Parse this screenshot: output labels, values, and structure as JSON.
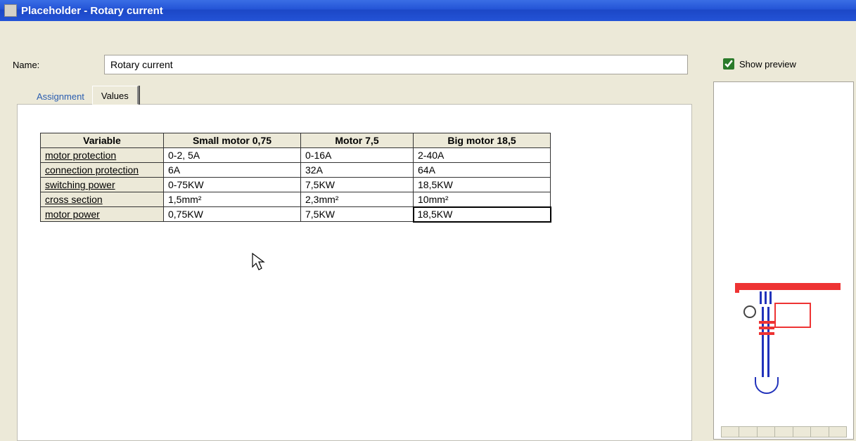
{
  "window": {
    "title": "Placeholder - Rotary current"
  },
  "name": {
    "label": "Name:",
    "value": "Rotary current"
  },
  "preview": {
    "label": "Show preview",
    "checked": true
  },
  "tabs": {
    "assignment": "Assignment",
    "values": "Values",
    "active": "values"
  },
  "table": {
    "headers": {
      "variable": "Variable",
      "columns": [
        "Small motor 0,75",
        "Motor 7,5",
        "Big motor 18,5"
      ]
    },
    "rows": [
      {
        "var": "motor protection",
        "cells": [
          "0-2, 5A",
          "0-16A",
          "2-40A"
        ]
      },
      {
        "var": "connection protection",
        "cells": [
          "6A",
          "32A",
          "64A"
        ]
      },
      {
        "var": "switching power",
        "cells": [
          "0-75KW",
          "7,5KW",
          "18,5KW"
        ]
      },
      {
        "var": "cross section",
        "cells": [
          "1,5mm²",
          "2,3mm²",
          "10mm²"
        ]
      },
      {
        "var": "motor power",
        "cells": [
          "0,75KW",
          "7,5KW",
          "18,5KW"
        ]
      }
    ],
    "selected": {
      "row": 4,
      "col": 2
    }
  }
}
